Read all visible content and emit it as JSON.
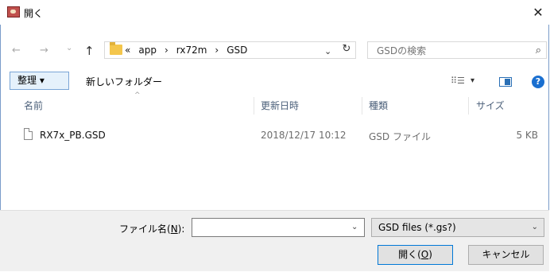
{
  "window": {
    "title": "開く",
    "close_glyph": "✕"
  },
  "nav": {
    "back": "←",
    "forward": "→",
    "recent": "⌄",
    "up": "↑"
  },
  "address": {
    "overflow": "«",
    "crumbs": [
      "app",
      "rx72m",
      "GSD"
    ],
    "separator": "›",
    "dropdown_glyph": "⌄",
    "refresh_glyph": "↻"
  },
  "search": {
    "placeholder": "GSDの検索",
    "icon_glyph": "⌕"
  },
  "toolbar": {
    "organize": "整理 ▾",
    "new_folder": "新しいフォルダー",
    "view_glyph": "⠿☰",
    "view_dd": "▾",
    "help": "?"
  },
  "columns": {
    "name": "名前",
    "date": "更新日時",
    "type": "種類",
    "size": "サイズ",
    "sort_glyph": "^"
  },
  "files": [
    {
      "name": "RX7x_PB.GSD",
      "date": "2018/12/17 10:12",
      "type": "GSD ファイル",
      "size": "5 KB"
    }
  ],
  "footer": {
    "filename_label": "ファイル名(",
    "filename_accel": "N",
    "filename_label_end": "):",
    "filename_value": "",
    "filter_value": "GSD files (*.gs?)",
    "open_label": "開く(",
    "open_accel": "O",
    "open_label_end": ")",
    "cancel_label": "キャンセル",
    "dd_glyph": "⌄"
  }
}
